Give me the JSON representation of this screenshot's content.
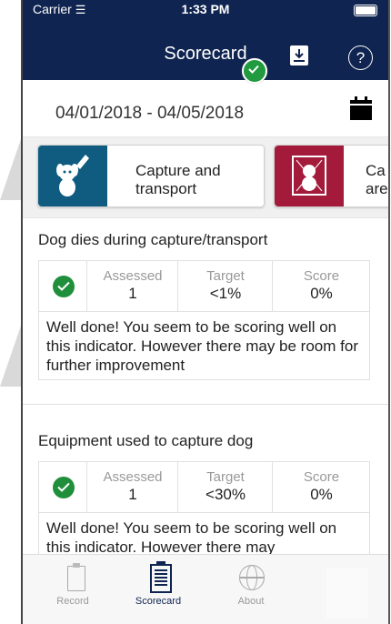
{
  "status_bar": {
    "carrier": "Carrier",
    "time": "1:33 PM"
  },
  "header": {
    "title": "Scorecard",
    "download_label": "",
    "help_label": "?"
  },
  "date_range": "04/01/2018 - 04/05/2018",
  "categories": [
    {
      "label": "Capture and transport",
      "color": "#0f5c80",
      "completed": true
    },
    {
      "label": "Ca are",
      "color": "#a31a3a",
      "completed": false
    }
  ],
  "indicators": [
    {
      "title": "Dog dies during capture/transport",
      "assessed_label": "Assessed",
      "assessed": "1",
      "target_label": "Target",
      "target": "<1%",
      "score_label": "Score",
      "score": "0%",
      "message": "Well done! You seem to be scoring well on this indicator. However there may be room for further improvement"
    },
    {
      "title": "Equipment used to capture dog",
      "assessed_label": "Assessed",
      "assessed": "1",
      "target_label": "Target",
      "target": "<30%",
      "score_label": "Score",
      "score": "0%",
      "message": "Well done! You seem to be scoring well on this indicator. However there may"
    }
  ],
  "tabs": [
    {
      "label": "Record",
      "icon": "clipboard-icon",
      "active": false
    },
    {
      "label": "Scorecard",
      "icon": "scorecard-icon",
      "active": true
    },
    {
      "label": "About",
      "icon": "globe-icon",
      "active": false
    }
  ],
  "colors": {
    "header": "#0f2450",
    "success": "#1f8f3b"
  }
}
